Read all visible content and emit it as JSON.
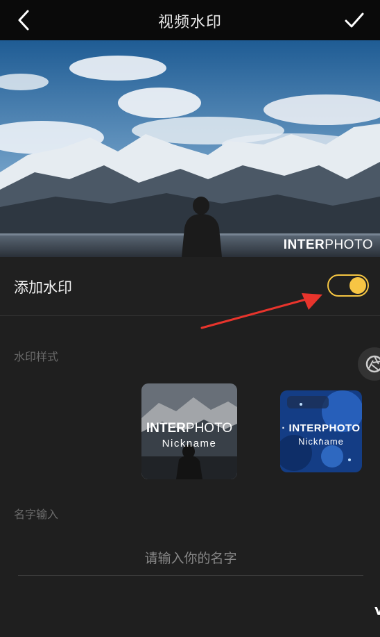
{
  "header": {
    "title": "视频水印",
    "back_icon": "chevron-left-icon",
    "confirm_icon": "checkmark-icon"
  },
  "preview": {
    "watermark_bold": "INTER",
    "watermark_thin": "PHOTO"
  },
  "toggle": {
    "label": "添加水印",
    "on": true,
    "accent": "#f7c544"
  },
  "style_section": {
    "label": "水印样式",
    "cards": [
      {
        "main_bold": "INTER",
        "main_thin": "PHOTO",
        "sub": "Nickname"
      },
      {
        "main": "· INTERPHOTO ·",
        "sub": "Nickname"
      }
    ]
  },
  "name_section": {
    "label": "名字输入",
    "placeholder": "请输入你的名字"
  },
  "colors": {
    "background": "#1f1f1f",
    "header": "#0a0a0a",
    "arrow": "#e8342c"
  }
}
